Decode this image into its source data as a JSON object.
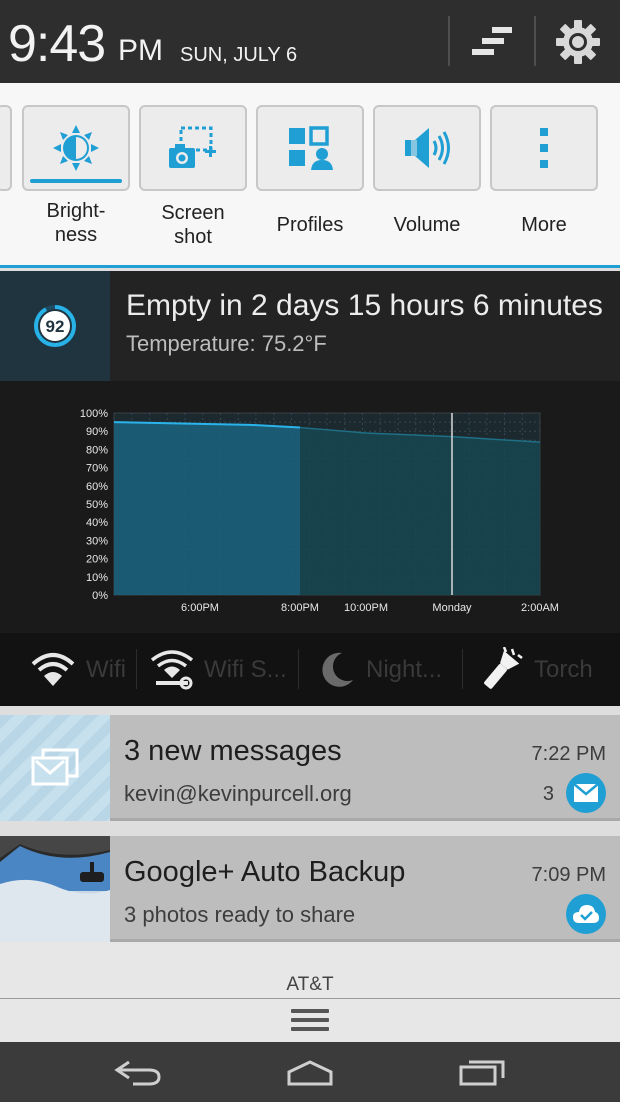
{
  "status": {
    "time": "9:43",
    "ampm": "PM",
    "date": "SUN, JULY 6",
    "icons": [
      "notification-list-icon",
      "settings-gear-icon"
    ]
  },
  "quick_toggles": [
    {
      "label": "Bright-\nness",
      "icon": "brightness-icon",
      "active": true
    },
    {
      "label": "Screen\nshot",
      "icon": "screenshot-icon",
      "active": false
    },
    {
      "label": "Profiles",
      "icon": "profiles-icon",
      "active": false
    },
    {
      "label": "Volume",
      "icon": "volume-icon",
      "active": false
    },
    {
      "label": "More",
      "icon": "more-vertical-icon",
      "active": false
    }
  ],
  "battery": {
    "level": "92",
    "title": "Empty in 2 days 15 hours 6 minutes",
    "subtitle": "Temperature: 75.2°F"
  },
  "chart_data": {
    "type": "area",
    "title": "",
    "xlabel": "",
    "ylabel": "",
    "y_ticks": [
      "100%",
      "90%",
      "80%",
      "70%",
      "60%",
      "50%",
      "40%",
      "30%",
      "20%",
      "10%",
      "0%"
    ],
    "x_ticks": [
      "6:00PM",
      "8:00PM",
      "10:00PM",
      "Monday",
      "2:00AM"
    ],
    "ylim": [
      0,
      100
    ],
    "series": [
      {
        "name": "",
        "kind": "history",
        "x": [
          "5:00PM",
          "6:00PM",
          "7:00PM",
          "8:00PM"
        ],
        "y": [
          95,
          94,
          93.5,
          92
        ]
      },
      {
        "name": "",
        "kind": "projection",
        "x": [
          "8:00PM",
          "10:00PM",
          "Monday",
          "2:00AM"
        ],
        "y": [
          92,
          89,
          87,
          84
        ]
      }
    ],
    "marker": "Monday",
    "grid": true
  },
  "widget_toggles": [
    {
      "label": "Wifi",
      "icon": "wifi-icon"
    },
    {
      "label": "Wifi S...",
      "icon": "wifi-settings-icon"
    },
    {
      "label": "Night...",
      "icon": "moon-icon"
    },
    {
      "label": "Torch",
      "icon": "flashlight-icon"
    }
  ],
  "notifications": [
    {
      "title": "3 new messages",
      "text": "kevin@kevinpurcell.org",
      "time": "7:22 PM",
      "count": "3",
      "icon": "gmail-icon",
      "badge": "mail-badge-icon"
    },
    {
      "title": "Google+ Auto Backup",
      "text": "3 photos ready to share",
      "time": "7:09 PM",
      "count": "",
      "icon": "photo-thumbnail",
      "badge": "cloud-check-icon"
    }
  ],
  "carrier": "AT&T",
  "nav": [
    "back-icon",
    "home-icon",
    "recents-icon"
  ],
  "colors": {
    "accent": "#1f9fd3",
    "header": "#2e2e2e",
    "chart_fill": "#1b5f7a"
  }
}
